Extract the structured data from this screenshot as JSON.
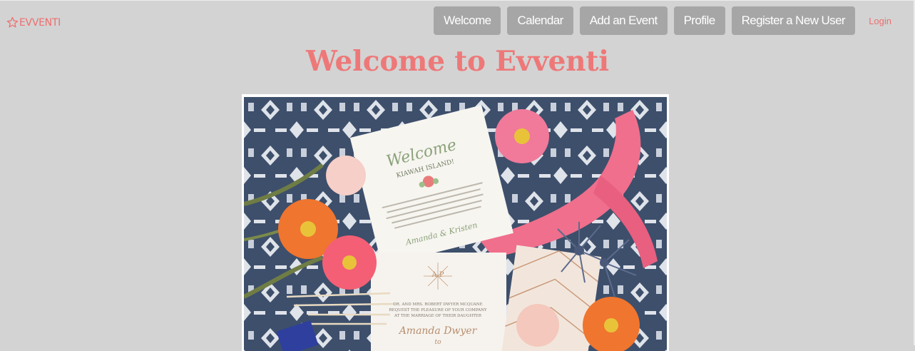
{
  "brand": {
    "name": "EVVENTI",
    "icon": "star-outline-icon",
    "color": "#ee6e6e"
  },
  "nav": {
    "items": [
      {
        "label": "Welcome"
      },
      {
        "label": "Calendar"
      },
      {
        "label": "Add an Event"
      },
      {
        "label": "Profile"
      },
      {
        "label": "Register a New User"
      }
    ],
    "button_color": "#a6a6a6"
  },
  "login": {
    "label": "Login"
  },
  "page": {
    "title": "Welcome to Evventi",
    "background": "#d3d3d3"
  },
  "hero": {
    "card_top": {
      "script": "Welcome",
      "subtitle": "KIAWAH ISLAND!",
      "signature": "Amanda & Kristen"
    },
    "card_bottom": {
      "monogram": "A  P",
      "line1": "DR. AND MRS. ROBERT DWYER MCQUANE",
      "line2": "REQUEST THE PLEASURE OF YOUR COMPANY",
      "line3": "AT THE MARRIAGE OF THEIR DAUGHTER",
      "name": "Amanda Dwyer",
      "to": "to"
    }
  }
}
